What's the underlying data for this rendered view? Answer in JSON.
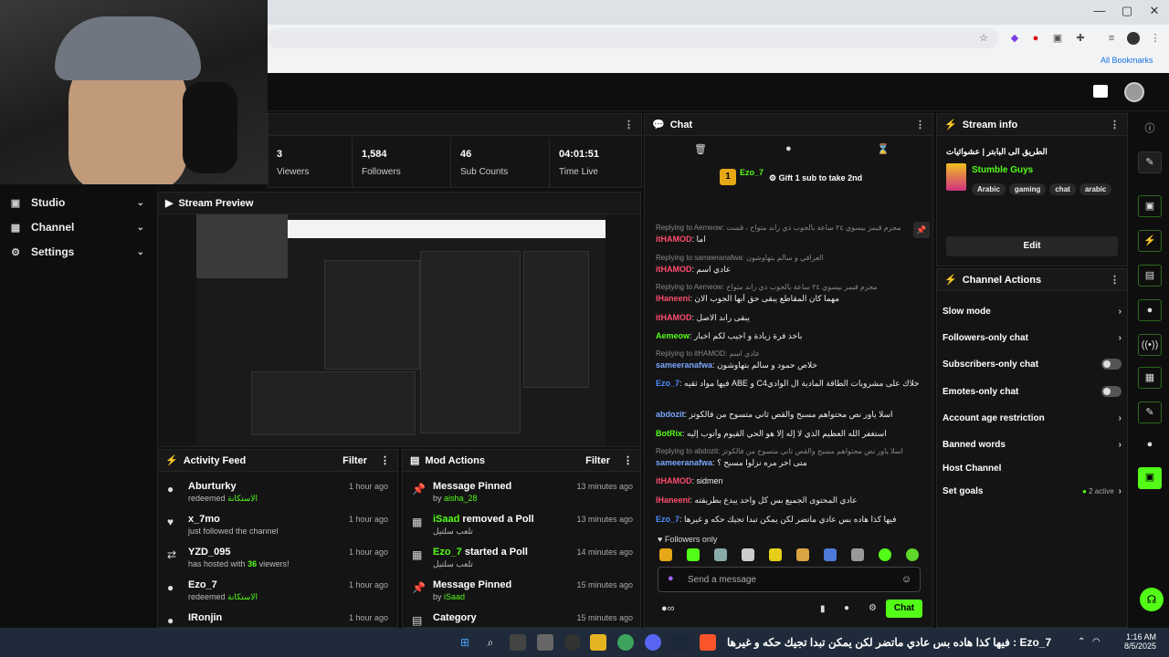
{
  "browser": {
    "all_bookmarks": "All Bookmarks"
  },
  "sidebar": {
    "items": [
      {
        "label": "Studio"
      },
      {
        "label": "Channel"
      },
      {
        "label": "Settings"
      }
    ]
  },
  "stats": {
    "items": [
      {
        "value": "3",
        "label": "Viewers"
      },
      {
        "value": "1,584",
        "label": "Followers"
      },
      {
        "value": "46",
        "label": "Sub Counts"
      },
      {
        "value": "04:01:51",
        "label": "Time Live"
      }
    ]
  },
  "preview": {
    "title": "Stream Preview"
  },
  "activity": {
    "title": "Activity Feed",
    "filter": "Filter",
    "items": [
      {
        "name": "Aburturky",
        "sub": "redeemed",
        "badge": "الاستكانة",
        "time": "1 hour ago"
      },
      {
        "name": "x_7mo",
        "sub": "just followed the channel",
        "time": "1 hour ago"
      },
      {
        "name": "YZD_095",
        "sub": "has hosted with",
        "count": "36",
        "sub2": "viewers!",
        "time": "1 hour ago"
      },
      {
        "name": "Ezo_7",
        "sub": "redeemed",
        "badge": "الاستكانة",
        "time": "1 hour ago"
      },
      {
        "name": "IRonjin",
        "time": "1 hour ago"
      }
    ]
  },
  "mod": {
    "title": "Mod Actions",
    "filter": "Filter",
    "items": [
      {
        "title": "Message Pinned",
        "by": "by",
        "who": "aisha_28",
        "time": "13 minutes ago"
      },
      {
        "title_user": "iSaad",
        "title": "removed a Poll",
        "sub": "تلعب سلتيل",
        "time": "13 minutes ago"
      },
      {
        "title_user": "Ezo_7",
        "title": "started a Poll",
        "sub": "تلعب سلتيل",
        "time": "14 minutes ago"
      },
      {
        "title": "Message Pinned",
        "by": "by",
        "who": "iSaad",
        "time": "15 minutes ago"
      },
      {
        "title": "Category",
        "time": "15 minutes ago"
      }
    ]
  },
  "chat": {
    "title": "Chat",
    "gift_user": "Ezo_7",
    "gift_count": "1",
    "gift_text": "Gift 1 sub to take 2nd",
    "messages": [
      {
        "reply": "Replying to Aemeow: مجرم قيمز بيسوي ٢٤ ساعة بالجوب ذي راند متواح ، قست",
        "user": "itHAMOD",
        "color": "#ff4d6d",
        "text": "اما"
      },
      {
        "reply": "Replying to sameeranafwa: العراقي و سالم بتهاوشون",
        "user": "itHAMOD",
        "color": "#ff4d6d",
        "text": "عادي اسم"
      },
      {
        "reply": "Replying to Aemeow: مجرم قيمز بيسوي ٢٤ ساعة بالجوب ذي راند متواح",
        "user": "IHaneeni",
        "color": "#ff4d6d",
        "text": "مهما كان المقاطع يبقى حق أبها الجوب الان"
      },
      {
        "user": "itHAMOD",
        "color": "#ff4d6d",
        "text": "يبقى راند الاصل"
      },
      {
        "user": "Aemeow",
        "color": "#53fc18",
        "text": "باخذ فرة زيادة و اجيب لكم اخبار"
      },
      {
        "reply": "Replying to itHAMOD: عادي اسم",
        "user": "sameeranafwa",
        "color": "#7aa7ff",
        "text": "خلاص حمود و سالم بتهاوشون"
      },
      {
        "user": "Ezo_7",
        "color": "#4d8dff",
        "text": "فيها مواد ثقيه ABE و C4خلاك على مشروبات الطاقة المادية ال الوادي"
      },
      {
        "user": "abdozit",
        "color": "#7aa7ff",
        "text": "اسلا ياور نص محتواهم مسبح والقص ثاني متسوح من فالكوتز"
      },
      {
        "user": "BotRix",
        "color": "#53fc18",
        "text": "استغفر الله العظيم الذي لا إله إلا هو الحي القيوم وأتوب إليه"
      },
      {
        "reply": "Replying to abdozit: اسلا ياور نص محتواهم مسبح والقص ثاني متسوح من فالكوتز",
        "user": "sameeranafwa",
        "color": "#7aa7ff",
        "text": "متى اخر مره نزلوا مسبح ؟"
      },
      {
        "user": "itHAMOD",
        "color": "#ff4d6d",
        "text": "sidmen"
      },
      {
        "user": "IHaneeni",
        "color": "#ff4d6d",
        "text": "عادي المحتوى الجميع بس كل واحد يبدع بطريقته"
      },
      {
        "user": "Ezo_7",
        "color": "#4d8dff",
        "text": "فيها كذا هاده بس عادي ماتضر لكن يمكن تبدا تجيك حكه و غيرها"
      }
    ],
    "followers_only": "Followers only",
    "input_placeholder": "Send a message",
    "send_label": "Chat"
  },
  "stream_info": {
    "title": "Stream info",
    "stream_title": "الطريق الى البابتر | عشوائيات",
    "category": "Stumble Guys",
    "tags": [
      "Arabic",
      "gaming",
      "chat",
      "arabic"
    ],
    "edit_label": "Edit"
  },
  "channel_actions": {
    "title": "Channel Actions",
    "items": [
      {
        "label": "Slow mode",
        "kind": "chevron"
      },
      {
        "label": "Followers-only chat",
        "kind": "chevron"
      },
      {
        "label": "Subscribers-only chat",
        "kind": "toggle"
      },
      {
        "label": "Emotes-only chat",
        "kind": "toggle"
      },
      {
        "label": "Account age restriction",
        "kind": "chevron"
      },
      {
        "label": "Banned words",
        "kind": "chevron"
      },
      {
        "label": "Host Channel",
        "kind": "none"
      },
      {
        "label": "Set goals",
        "kind": "chevron",
        "status": "2 active"
      }
    ]
  },
  "taskbar": {
    "ticker": "فيها كذا هاده بس عادي ماتضر لكن يمكن تبدا تجيك حكه و غيرها : Ezo_7",
    "time": "1:16 AM",
    "date": "8/5/2025"
  },
  "colors": {
    "accent": "#53fc18",
    "panel": "#141414",
    "background": "#0f0f0f"
  }
}
